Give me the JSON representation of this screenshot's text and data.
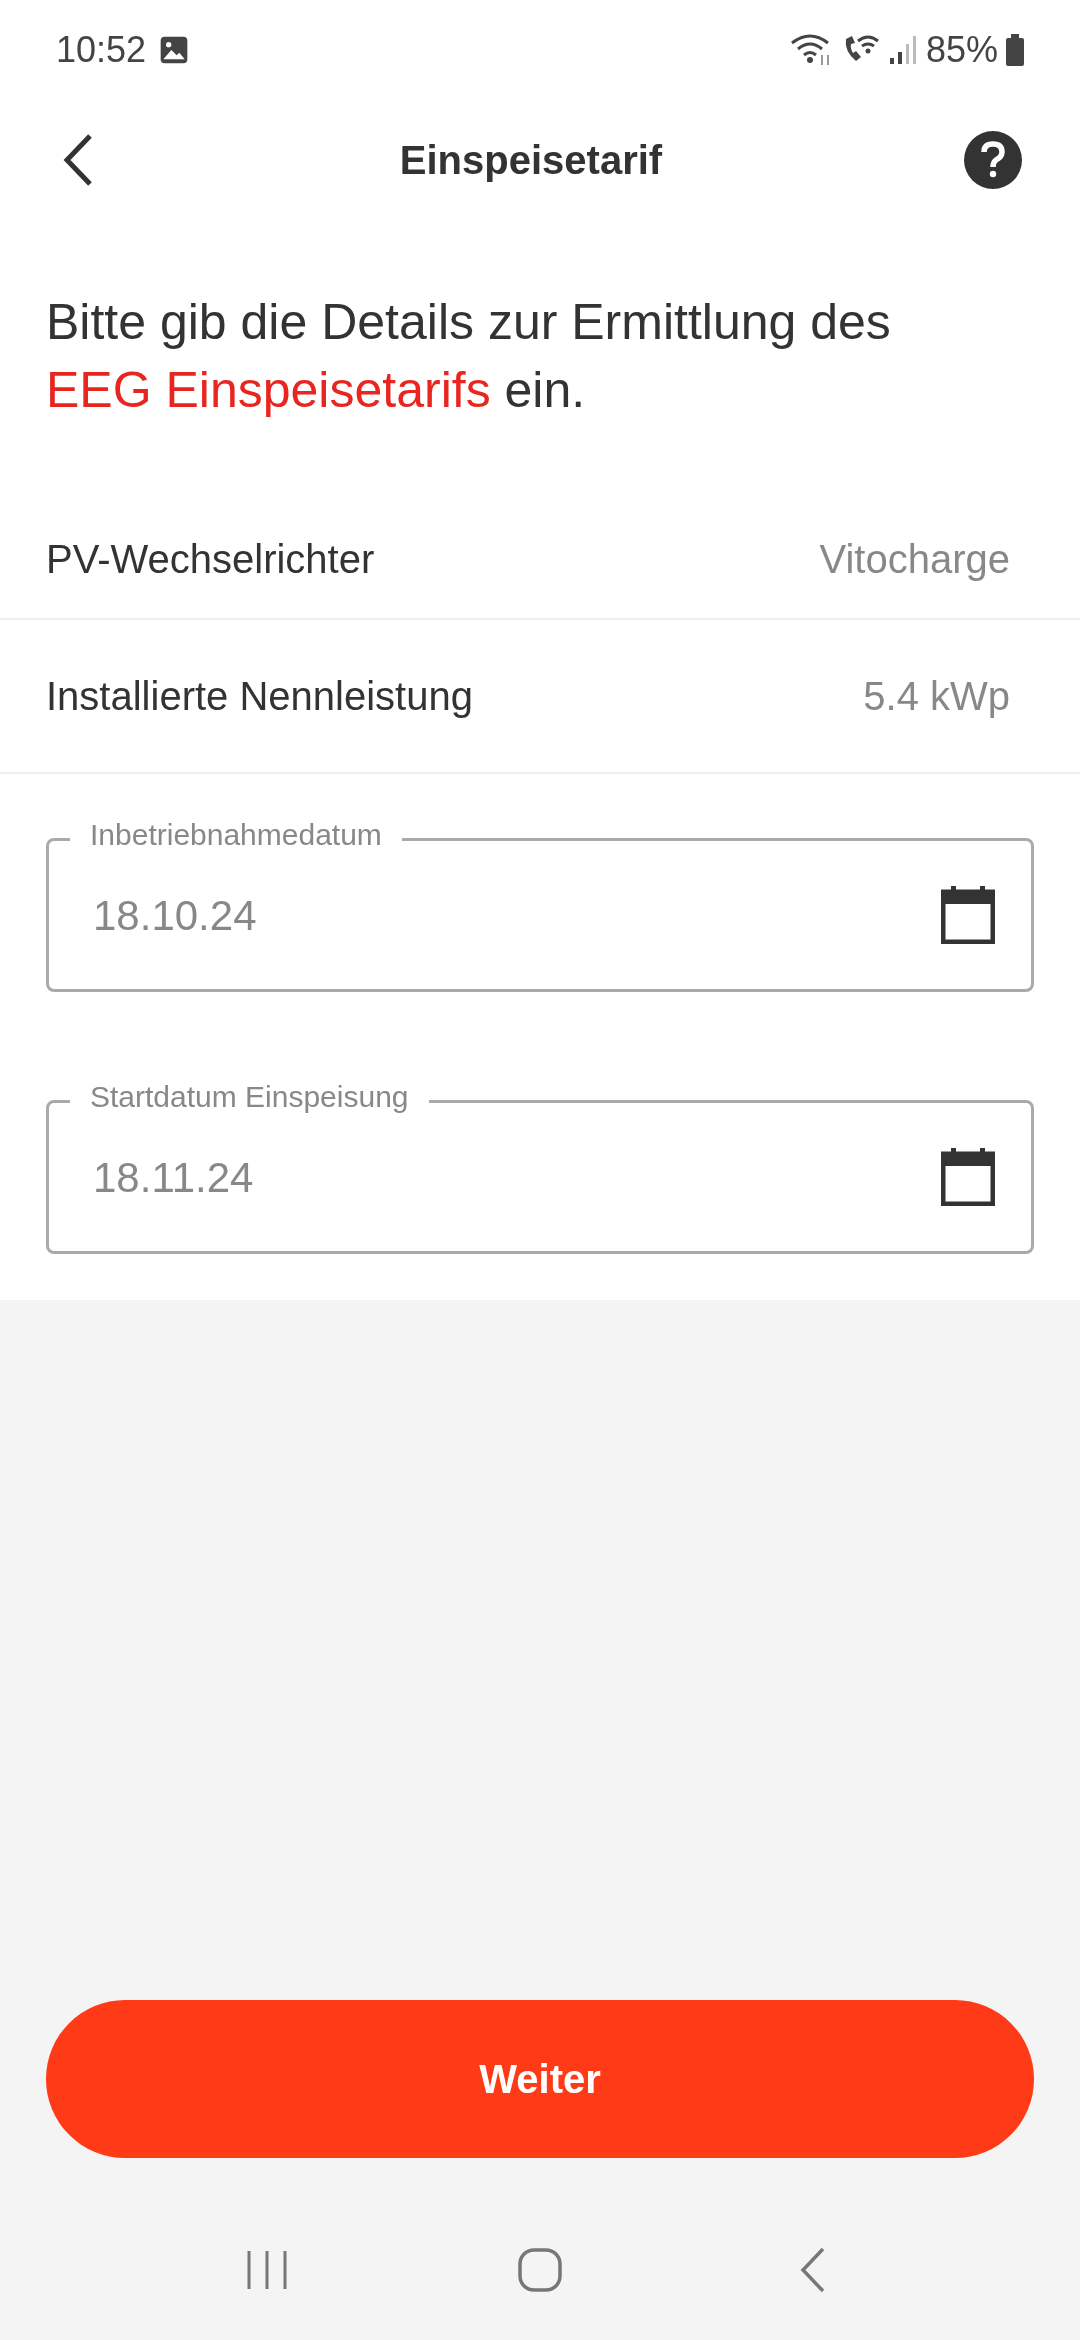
{
  "status_bar": {
    "time": "10:52",
    "battery": "85%"
  },
  "header": {
    "title": "Einspeisetarif"
  },
  "intro": {
    "before": "Bitte gib die Details zur Ermittlung des",
    "link": "EEG Einspeisetarifs",
    "after": "ein."
  },
  "info_rows": [
    {
      "label": "PV-Wechselrichter",
      "value": "Vitocharge"
    },
    {
      "label": "Installierte Nennleistung",
      "value": "5.4 kWp"
    }
  ],
  "date_fields": [
    {
      "label": "Inbetriebnahmedatum",
      "value": "18.10.24"
    },
    {
      "label": "Startdatum Einspeisung",
      "value": "18.11.24"
    }
  ],
  "primary_button": "Weiter"
}
